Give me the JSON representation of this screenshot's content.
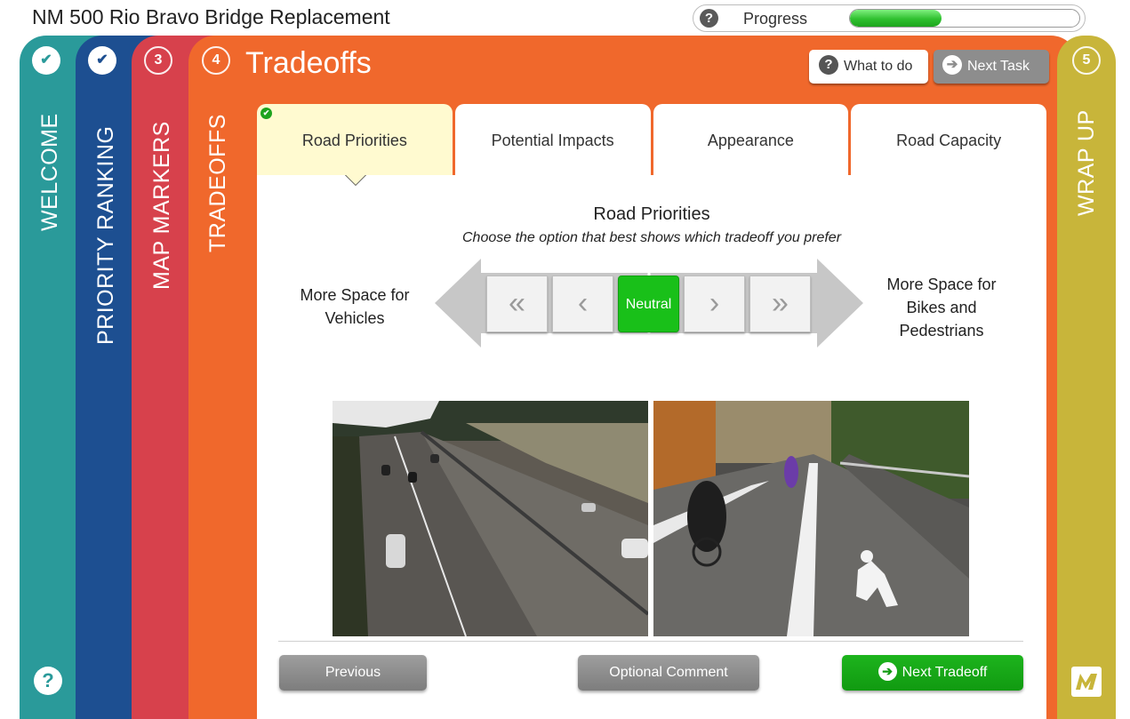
{
  "app": {
    "title": "NM 500 Rio Bravo Bridge Replacement"
  },
  "progress": {
    "label": "Progress",
    "help_icon": "?",
    "fraction": 0.4
  },
  "steps": [
    {
      "number": "✔",
      "label": "WELCOME",
      "status": "done"
    },
    {
      "number": "✔",
      "label": "PRIORITY RANKING",
      "status": "done"
    },
    {
      "number": "3",
      "label": "MAP MARKERS",
      "status": "todo"
    },
    {
      "number": "4",
      "label": "TRADEOFFS",
      "status": "current"
    },
    {
      "number": "5",
      "label": "WRAP UP",
      "status": "todo"
    }
  ],
  "header": {
    "title": "Tradeoffs",
    "what_to_do": "What to do",
    "what_to_do_icon": "?",
    "next_task": "Next Task",
    "next_task_icon": "➔"
  },
  "tabs": [
    {
      "label": "Road Priorities",
      "active": true,
      "completed": true
    },
    {
      "label": "Potential Impacts",
      "active": false,
      "completed": false
    },
    {
      "label": "Appearance",
      "active": false,
      "completed": false
    },
    {
      "label": "Road Capacity",
      "active": false,
      "completed": false
    }
  ],
  "question": {
    "title": "Road Priorities",
    "subtitle": "Choose the option that best shows which tradeoff you prefer",
    "left_label": "More Space for Vehicles",
    "right_label": "More Space for Bikes and Pedestrians",
    "scale": [
      "«",
      "‹",
      "Neutral",
      "›",
      "»"
    ],
    "selected": "Neutral"
  },
  "footer": {
    "previous": "Previous",
    "comment": "Optional Comment",
    "next": "Next Tradeoff",
    "next_icon": "➔"
  },
  "sidebar": {
    "help_icon": "?"
  },
  "colors": {
    "welcome": "#2a9a9a",
    "priority": "#1d4f91",
    "markers": "#d7414c",
    "tradeoffs": "#f0682c",
    "wrapup": "#c8b53a",
    "accent_green": "#19c019"
  }
}
